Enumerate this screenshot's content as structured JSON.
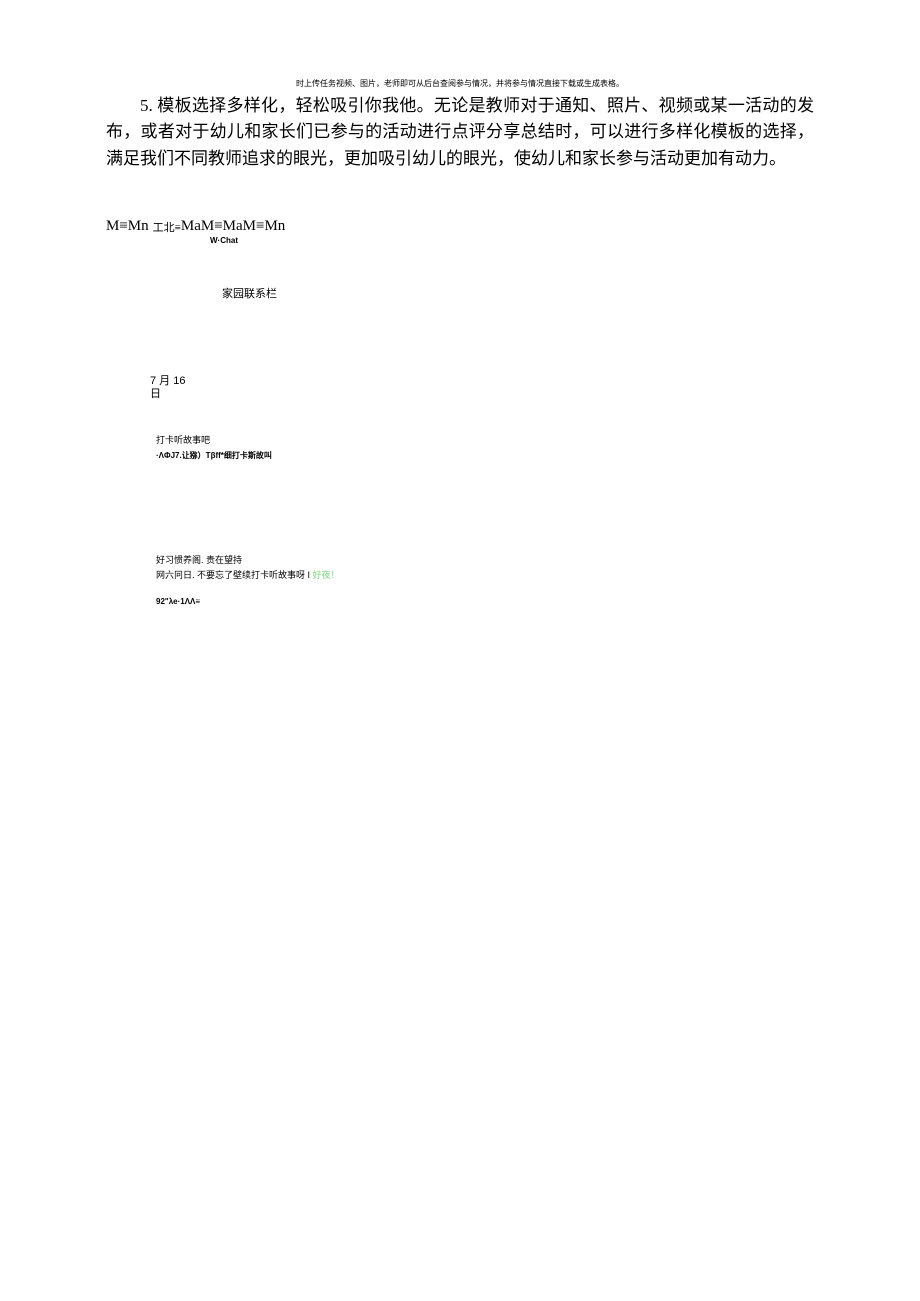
{
  "tiny_header": "时上传任务视频、图片，老师即可从后台查阅参与情况，并将参与情况直接下载或生成表格。",
  "paragraph": {
    "prefix": "5. 模板选择多样化，轻松吸引你我他。无论是教师对于通知、照片、视频或某一活动的发布，或者对于幼儿和家长们已参与的活动进行点评分享总结时，可以进行多样化模板的选择，满足我们不同教师追求的眼光，更加吸引幼儿的眼光，使幼儿和家长参与活动更加有动力。"
  },
  "label": {
    "seg1": "M≡Mn",
    "seg2": "工北≡",
    "seg3": "MaM≡MaM≡Mn",
    "wchat": "W·Chat"
  },
  "section_title": "家园联系栏",
  "date": {
    "line1": "7 月 16",
    "line2": "日"
  },
  "card": {
    "title": "打卡听故事吧",
    "sub": "·ΛΦJ7.让猕）Tβff*细打卡斯故叫"
  },
  "habit": {
    "line1": "好习惯养阁. 贵在望持",
    "line2_a": "网六冋日. 不要忘了壁续打卡听故事呀 I ",
    "line2_b": "好夜！"
  },
  "code": "92\"λe·1ΛΛ≡"
}
